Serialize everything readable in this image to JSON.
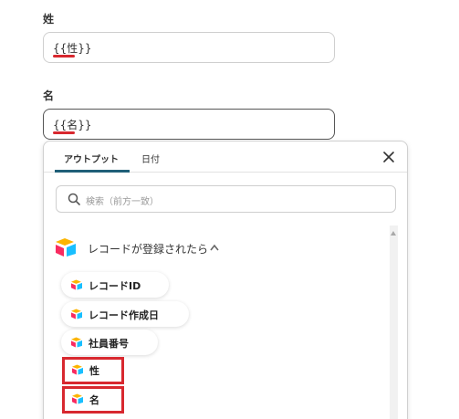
{
  "fields": [
    {
      "label": "姓",
      "value": "{{性}}"
    },
    {
      "label": "名",
      "value": "{{名}}"
    }
  ],
  "dropdown": {
    "tabs": [
      {
        "label": "アウトプット",
        "active": true
      },
      {
        "label": "日付",
        "active": false
      }
    ],
    "search_placeholder": "検索（前方一致）",
    "group": {
      "label": "レコードが登録されたら",
      "expanded": true,
      "icon": "airtable-icon",
      "items": [
        {
          "label": "レコードID",
          "highlighted": false
        },
        {
          "label": "レコード作成日",
          "highlighted": false
        },
        {
          "label": "社員番号",
          "highlighted": false
        },
        {
          "label": "性",
          "highlighted": true
        },
        {
          "label": "名",
          "highlighted": true
        }
      ]
    }
  },
  "colors": {
    "accent_red": "#d8282f",
    "tab_indicator": "#1f5f78",
    "airtable_yellow": "#fcb400",
    "airtable_blue": "#18bfff",
    "airtable_red": "#f82b60"
  }
}
